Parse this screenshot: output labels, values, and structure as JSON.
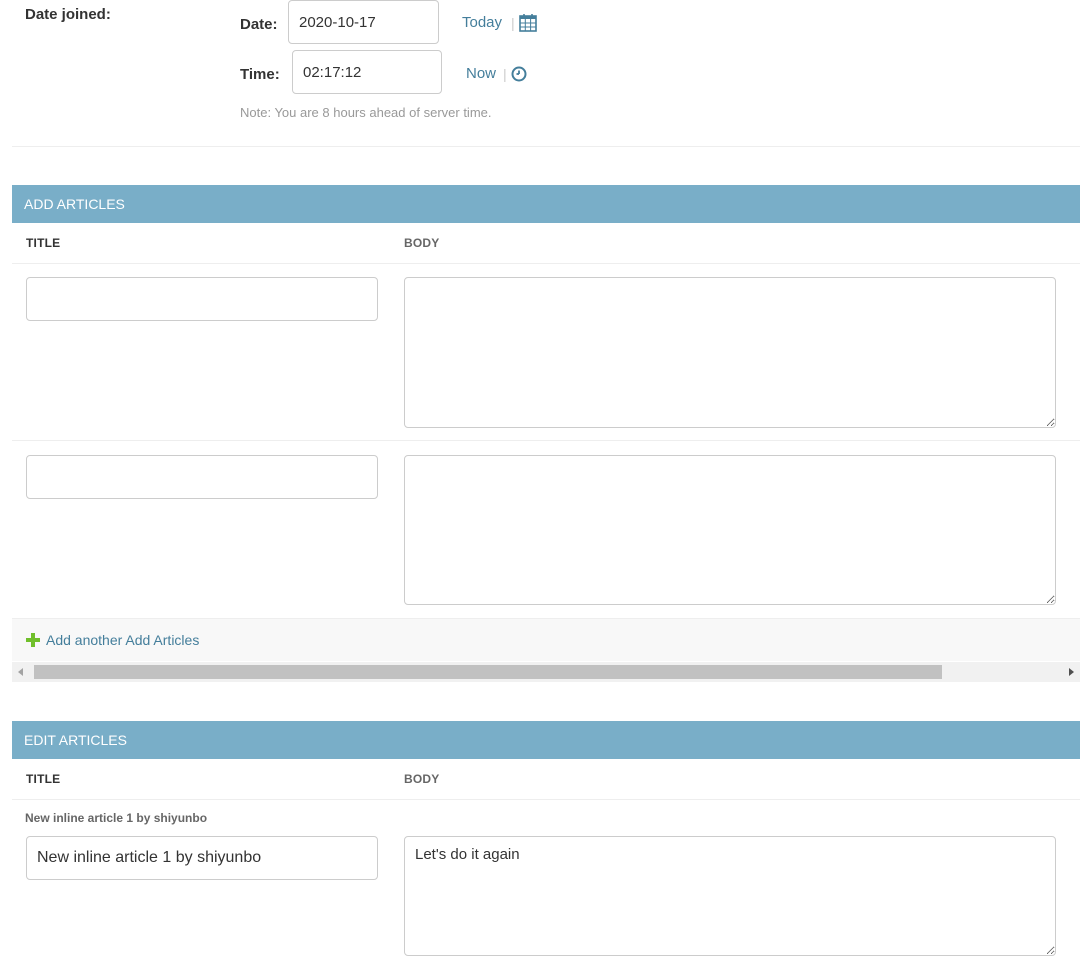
{
  "date_joined": {
    "label": "Date joined:",
    "date_label": "Date:",
    "date_value": "2020-10-17",
    "today_link": "Today",
    "separator": "|",
    "calendar_icon": "calendar-icon",
    "time_label": "Time:",
    "time_value": "02:17:12",
    "now_link": "Now",
    "clock_icon": "clock-icon",
    "note": "Note: You are 8 hours ahead of server time."
  },
  "add_articles": {
    "header": "ADD ARTICLES",
    "col_title": "TITLE",
    "col_body": "BODY",
    "rows": [
      {
        "title": "",
        "body": ""
      },
      {
        "title": "",
        "body": ""
      }
    ],
    "add_another": "Add another Add Articles",
    "add_icon": "plus-icon"
  },
  "edit_articles": {
    "header": "EDIT ARTICLES",
    "col_title": "TITLE",
    "col_body": "BODY",
    "rows": [
      {
        "original": "New inline article 1 by shiyunbo",
        "title": "New inline article 1 by shiyunbo",
        "body": "Let's do it again"
      }
    ]
  },
  "colors": {
    "section_header": "#79aec8",
    "link": "#447e9b",
    "add_icon": "#70bf2b"
  }
}
